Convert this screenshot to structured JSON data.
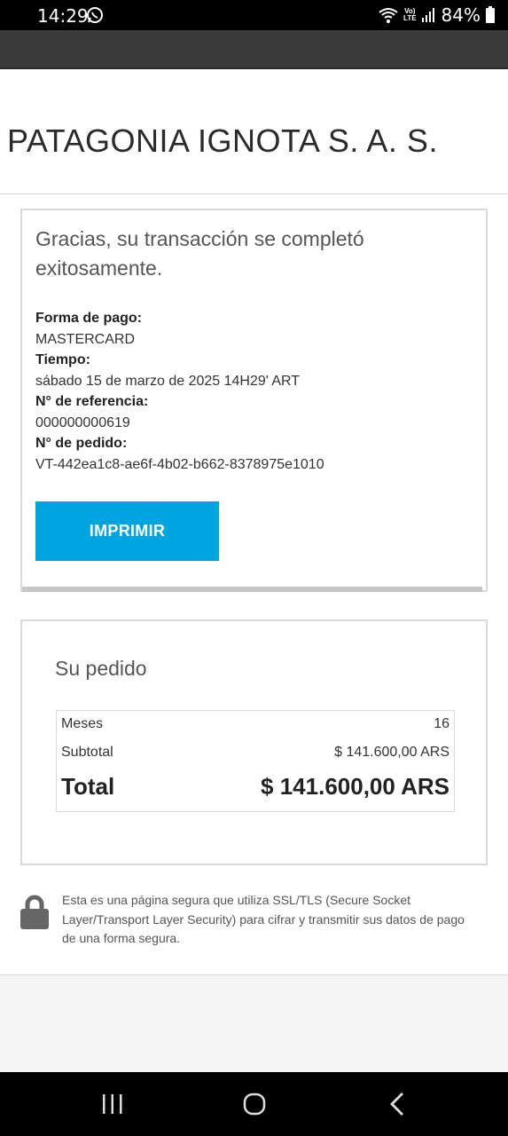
{
  "status_bar": {
    "time": "14:29",
    "battery_percent": "84%",
    "icons": [
      "whatsapp-icon",
      "wifi-icon",
      "volte-icon",
      "signal-icon",
      "battery-icon"
    ],
    "volte_label_top": "Vo)",
    "volte_label_bottom": "LTE"
  },
  "merchant": {
    "name": "PATAGONIA IGNOTA S. A. S."
  },
  "confirmation": {
    "message": "Gracias, su transacción se completó exitosamente.",
    "fields": [
      {
        "label": "Forma de pago:",
        "value": "MASTERCARD"
      },
      {
        "label": "Tiempo:",
        "value": "sábado 15 de marzo de 2025 14H29' ART"
      },
      {
        "label": "N° de referencia:",
        "value": "000000000619"
      },
      {
        "label": "N° de pedido:",
        "value": "VT-442ea1c8-ae6f-4b02-b662-8378975e1010"
      }
    ],
    "print_button": "IMPRIMIR",
    "accent_color": "#00a5df"
  },
  "order": {
    "title": "Su pedido",
    "rows": [
      {
        "label": "Meses",
        "value": "16"
      },
      {
        "label": "Subtotal",
        "value": "$ 141.600,00 ARS"
      }
    ],
    "total": {
      "label": "Total",
      "value": "$ 141.600,00 ARS"
    }
  },
  "security": {
    "icon": "lock-icon",
    "text": "Esta es una página segura que utiliza SSL/TLS (Secure Socket Layer/Transport Layer Security) para cifrar y transmitir sus datos de pago de una forma segura."
  },
  "nav_bar": {
    "buttons": [
      "recents-icon",
      "home-icon",
      "back-icon"
    ]
  }
}
